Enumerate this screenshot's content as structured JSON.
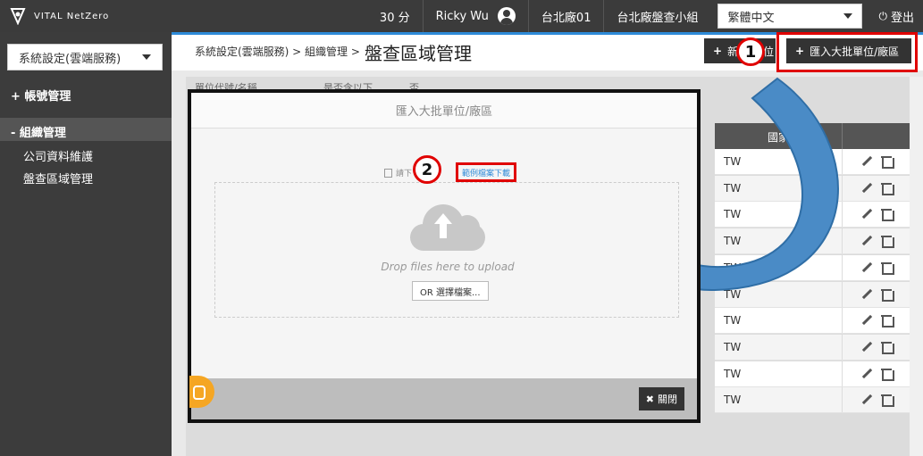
{
  "topbar": {
    "brand": "VITAL NetZero",
    "points": "30 分",
    "user_name": "Ricky Wu",
    "factory": "台北廠01",
    "team": "台北廠盤查小組",
    "language": "繁體中文",
    "logout": "登出"
  },
  "sidebar": {
    "selector": "系統設定(雲端服務)",
    "items": [
      {
        "label": "+ 帳號管理"
      },
      {
        "label": "- 組織管理"
      }
    ],
    "subitems": [
      {
        "label": "公司資料維護"
      },
      {
        "label": "盤查區域管理"
      }
    ]
  },
  "header": {
    "breadcrumb": "系統設定(雲端服務) > 組織管理 >",
    "title": "盤查區域管理",
    "add_button": "新",
    "add_button_tail": "位",
    "import_button": "匯入大批單位/廠區"
  },
  "filters": {
    "unit_label": "單位代號/名稱",
    "include_label": "是否含以下",
    "toggle_no": "否"
  },
  "table": {
    "headers": [
      "國家"
    ],
    "rows": [
      {
        "country": "TW"
      },
      {
        "country": "TW"
      },
      {
        "country": "TW"
      },
      {
        "country": "TW"
      },
      {
        "country": "TW"
      },
      {
        "country": "TW"
      },
      {
        "country": "TW"
      },
      {
        "country": "TW"
      },
      {
        "country": "TW"
      },
      {
        "country": "TW"
      }
    ]
  },
  "modal": {
    "title": "匯入大批單位/廠區",
    "hint_prefix": "請下",
    "sample_link": "範例檔案下載",
    "drop_text": "Drop files here to upload",
    "choose_button": "OR 選擇檔案...",
    "close_button": "關閉"
  },
  "annotations": {
    "step1": "1",
    "step2": "2"
  },
  "colors": {
    "accent": "#2e8bd8",
    "highlight": "#e00000",
    "topbar": "#3b3b3b"
  }
}
